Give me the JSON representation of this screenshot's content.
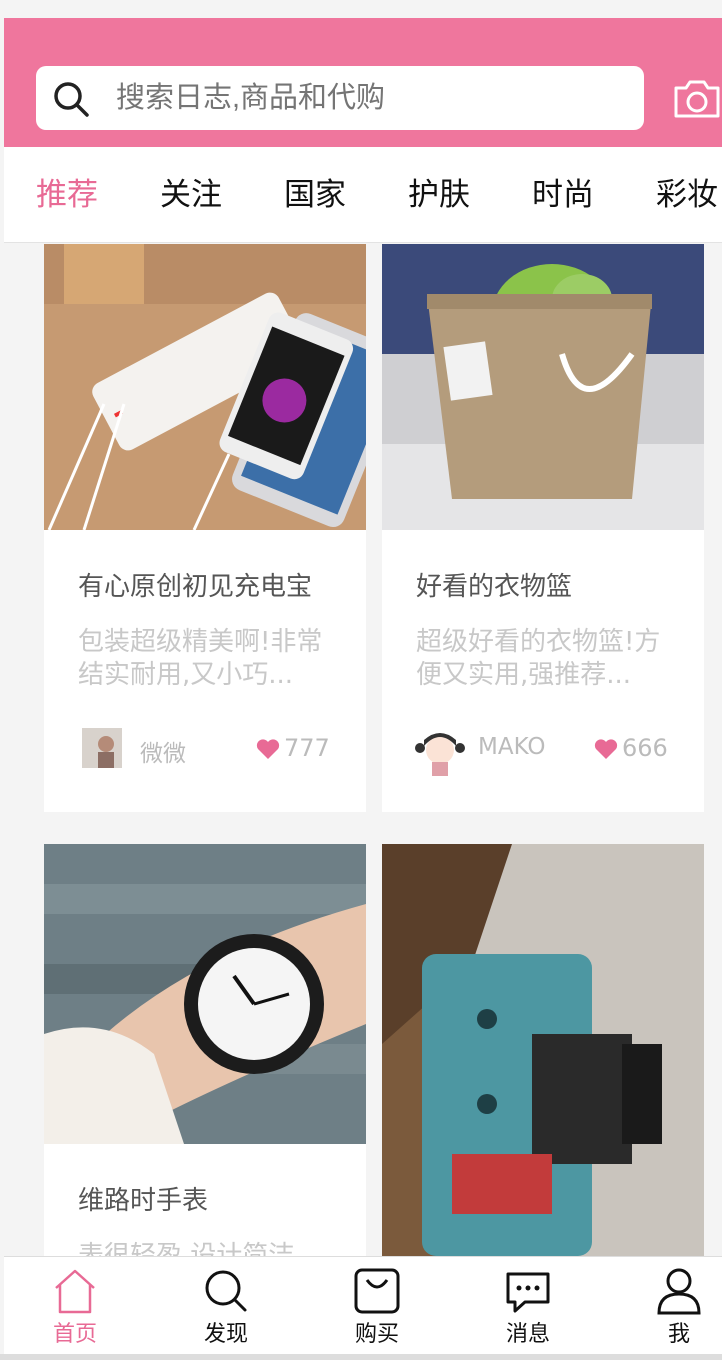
{
  "search": {
    "placeholder": "搜索日志,商品和代购"
  },
  "tabs": [
    {
      "label": "推荐",
      "active": true
    },
    {
      "label": "关注"
    },
    {
      "label": "国家"
    },
    {
      "label": "护肤"
    },
    {
      "label": "时尚"
    },
    {
      "label": "彩妆"
    }
  ],
  "cards": [
    {
      "title": "有心原创初见充电宝",
      "desc": "包装超级精美啊!非常结实耐用,又小巧...",
      "user": "微微",
      "likes": "777"
    },
    {
      "title": "好看的衣物篮",
      "desc": "超级好看的衣物篮!方便又实用,强推荐...",
      "user": "MAKO",
      "likes": "666"
    },
    {
      "title": "维路时手表",
      "desc": "表很轻盈,设计简洁"
    },
    {
      "title": ""
    }
  ],
  "tabbar": [
    {
      "label": "首页",
      "icon": "home-icon",
      "active": true
    },
    {
      "label": "发现",
      "icon": "discover-icon"
    },
    {
      "label": "购买",
      "icon": "bag-icon"
    },
    {
      "label": "消息",
      "icon": "message-icon"
    },
    {
      "label": "我",
      "icon": "user-icon"
    }
  ],
  "colors": {
    "brand": "#ef769d",
    "accent": "#e86a95"
  }
}
